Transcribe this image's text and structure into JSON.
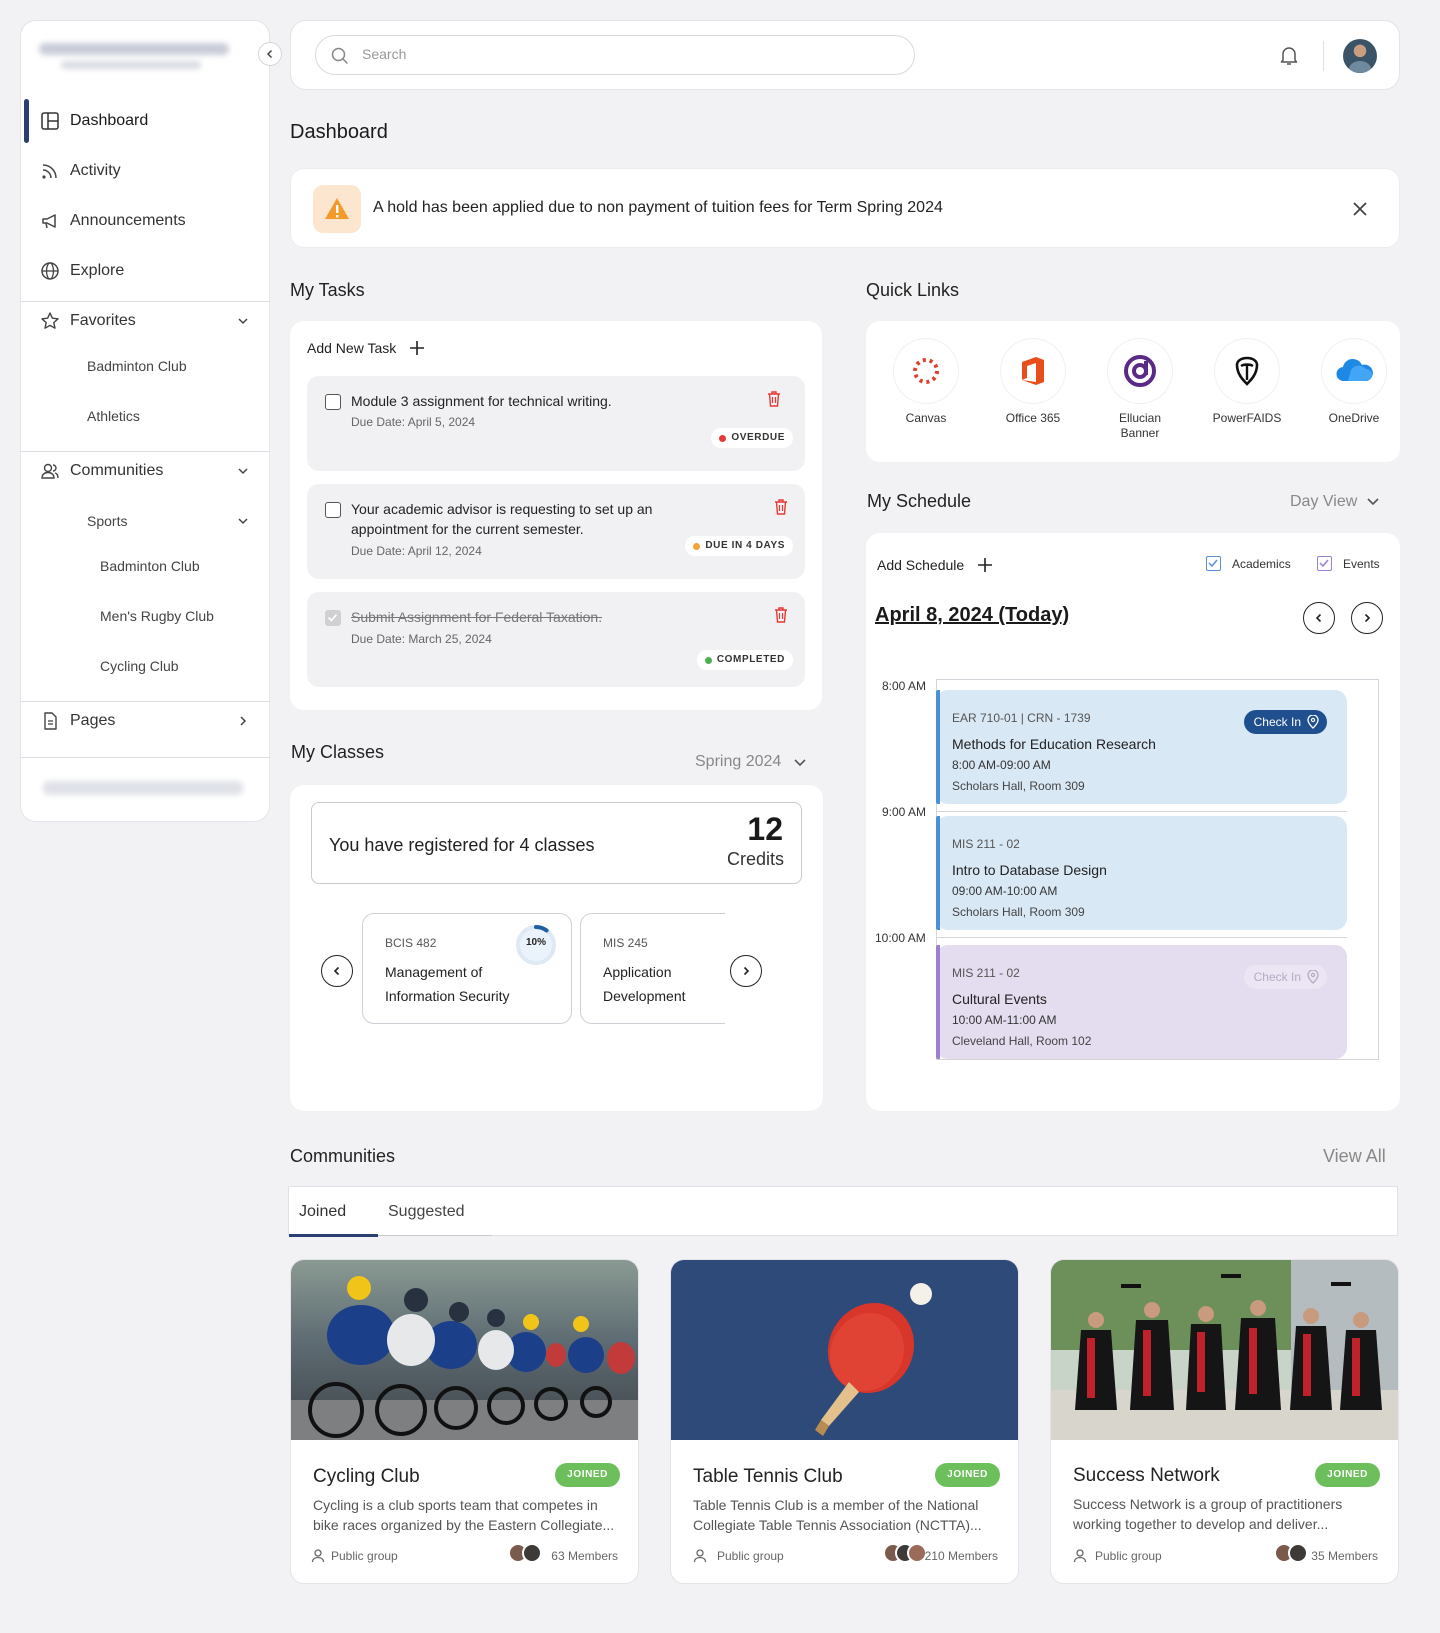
{
  "colors": {
    "accent": "#2c3f73",
    "brand_blue": "#1f4f8f",
    "joined_green": "#6cbf5a",
    "overdue_red": "#e53935",
    "due_orange": "#f2a33a",
    "completed_green": "#4caf50"
  },
  "topbar": {
    "search_placeholder": "Search"
  },
  "sidebar": {
    "items": [
      {
        "label": "Dashboard",
        "icon": "dashboard-icon"
      },
      {
        "label": "Activity",
        "icon": "rss-icon"
      },
      {
        "label": "Announcements",
        "icon": "megaphone-icon"
      },
      {
        "label": "Explore",
        "icon": "globe-icon"
      }
    ],
    "favorites": {
      "label": "Favorites",
      "items": [
        "Badminton Club",
        "Athletics"
      ]
    },
    "communities": {
      "label": "Communities",
      "sports": "Sports",
      "items": [
        "Badminton Club",
        "Men's Rugby Club",
        "Cycling Club"
      ]
    },
    "pages": {
      "label": "Pages"
    }
  },
  "page": {
    "title": "Dashboard"
  },
  "alert": {
    "text": "A hold has been applied due to non payment of tuition fees for Term Spring 2024"
  },
  "tasks": {
    "title": "My Tasks",
    "add_label": "Add New Task",
    "items": [
      {
        "title": "Module 3 assignment for technical writing.",
        "due": "Due Date: April 5, 2024",
        "status": "OVERDUE"
      },
      {
        "title": "Your academic advisor is requesting to set up an appointment for the current semester.",
        "due": "Due Date: April 12, 2024",
        "status": "DUE IN 4 DAYS"
      },
      {
        "title": "Submit Assignment for Federal Taxation.",
        "due": "Due Date: March 25, 2024",
        "status": "COMPLETED"
      }
    ]
  },
  "quick_links": {
    "title": "Quick Links",
    "items": [
      {
        "label": "Canvas",
        "icon": "canvas-icon"
      },
      {
        "label": "Office 365",
        "icon": "office-icon"
      },
      {
        "label": "Ellucian Banner",
        "icon": "ellucian-icon"
      },
      {
        "label": "PowerFAIDS",
        "icon": "powerfaids-icon"
      },
      {
        "label": "OneDrive",
        "icon": "onedrive-icon"
      }
    ]
  },
  "schedule": {
    "title": "My Schedule",
    "view": "Day View",
    "add_label": "Add Schedule",
    "filters": [
      "Academics",
      "Events"
    ],
    "date": "April 8, 2024 (Today)",
    "times": [
      "8:00 AM",
      "9:00 AM",
      "10:00 AM"
    ],
    "events": [
      {
        "code": "EAR 710-01 | CRN - 1739",
        "title": "Methods for Education Research",
        "time": "8:00 AM-09:00 AM",
        "location": "Scholars Hall, Room 309",
        "checkin": "Check In"
      },
      {
        "code": "MIS 211 - 02",
        "title": "Intro to Database Design",
        "time": "09:00 AM-10:00 AM",
        "location": "Scholars Hall, Room 309"
      },
      {
        "code": "MIS 211 - 02",
        "title": "Cultural Events",
        "time": "10:00 AM-11:00 AM",
        "location": "Cleveland Hall, Room 102",
        "checkin": "Check In"
      }
    ]
  },
  "classes": {
    "title": "My Classes",
    "term": "Spring 2024",
    "registered_text": "You have registered for 4 classes",
    "credits_value": "12",
    "credits_label": "Credits",
    "items": [
      {
        "code": "BCIS 482",
        "name": "Management of Information Security",
        "progress_label": "10%",
        "progress": 0.1
      },
      {
        "code": "MIS 245",
        "name": "Application Development"
      }
    ]
  },
  "communities": {
    "title": "Communities",
    "view_all": "View All",
    "tabs": [
      "Joined",
      "Suggested"
    ],
    "cards": [
      {
        "name": "Cycling Club",
        "badge": "JOINED",
        "desc": "Cycling is a club sports team that competes in bike races organized by the Eastern Collegiate...",
        "type": "Public group",
        "members": "63 Members"
      },
      {
        "name": "Table Tennis Club",
        "badge": "JOINED",
        "desc": "Table Tennis Club is a member of the National Collegiate Table Tennis Association (NCTTA)...",
        "type": "Public group",
        "members": "210 Members"
      },
      {
        "name": "Success Network",
        "badge": "JOINED",
        "desc": "Success Network is a group of practitioners working together to develop and deliver...",
        "type": "Public group",
        "members": "35 Members"
      }
    ]
  }
}
